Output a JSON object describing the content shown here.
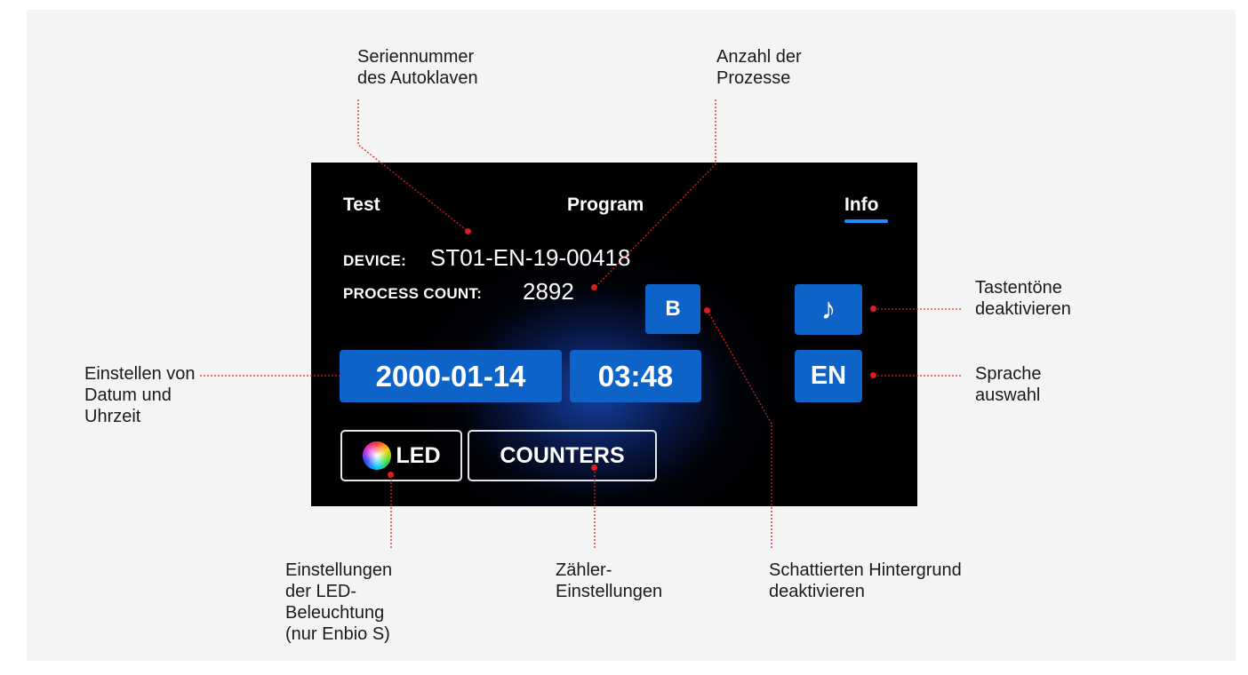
{
  "tabs": {
    "test": "Test",
    "program": "Program",
    "info": "Info"
  },
  "device": {
    "label": "DEVICE:",
    "value": "ST01-EN-19-00418"
  },
  "process_count": {
    "label": "PROCESS COUNT:",
    "value": "2892"
  },
  "buttons": {
    "shading": "B",
    "sound_icon": "♪",
    "language": "EN",
    "date": "2000-01-14",
    "time": "03:48",
    "led": "LED",
    "counters": "COUNTERS"
  },
  "annotations": {
    "serial": [
      "Seriennummer",
      "des Autoklaven"
    ],
    "process": [
      "Anzahl der",
      "Prozesse"
    ],
    "sound": [
      "Tastentöne",
      "deaktivieren"
    ],
    "language": [
      "Sprache",
      "auswahl"
    ],
    "datetime": [
      "Einstellen von",
      "Datum und",
      "Uhrzeit"
    ],
    "led": [
      "Einstellungen",
      "der LED-",
      "Beleuchtung",
      "(nur Enbio S)"
    ],
    "counters": [
      "Zähler-",
      "Einstellungen"
    ],
    "shading": [
      "Schattierten Hintergrund",
      "deaktivieren"
    ]
  },
  "colors": {
    "accent_blue": "#0d63c8",
    "pointer_red": "#e01c1c",
    "tab_underline": "#1e8fff"
  }
}
